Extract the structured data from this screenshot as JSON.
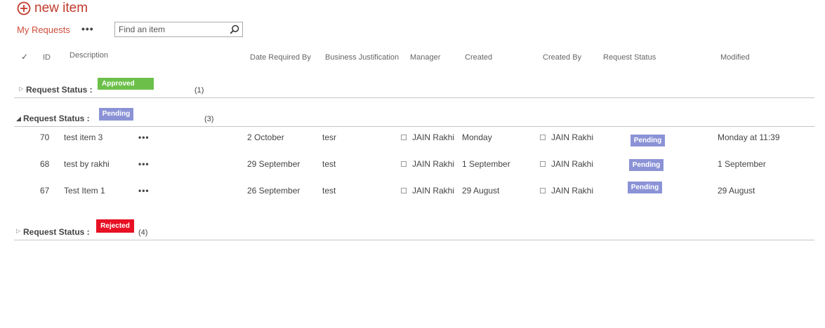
{
  "toolbar": {
    "new_item_label": "new item"
  },
  "view": {
    "name": "My Requests",
    "more": "•••"
  },
  "search": {
    "placeholder": "Find an item"
  },
  "columns": {
    "check": "✓",
    "id": "ID",
    "description": "Description",
    "date_required_by": "Date Required By",
    "business_justification": "Business Justification",
    "manager": "Manager",
    "created": "Created",
    "created_by": "Created By",
    "request_status": "Request Status",
    "modified": "Modified"
  },
  "groups": [
    {
      "label": "Request Status :",
      "status": "Approved",
      "count": "(1)",
      "color": "#6cc04a",
      "expanded": false
    },
    {
      "label": "Request Status :",
      "status": "Pending",
      "count": "(3)",
      "color": "#8b93d6",
      "expanded": true
    },
    {
      "label": "Request Status :",
      "status": "Rejected",
      "count": "(4)",
      "color": "#e81123",
      "expanded": false
    }
  ],
  "rows": [
    {
      "id": "70",
      "description": "test item 3",
      "more": "•••",
      "date_required_by": "2 October",
      "business_justification": "tesr",
      "manager": "JAIN Rakhi",
      "created": "Monday",
      "created_by": "JAIN Rakhi",
      "request_status": "Pending",
      "modified": "Monday at 11:39"
    },
    {
      "id": "68",
      "description": "test by rakhi",
      "more": "•••",
      "date_required_by": "29 September",
      "business_justification": "test",
      "manager": "JAIN Rakhi",
      "created": "1 September",
      "created_by": "JAIN Rakhi",
      "request_status": "Pending",
      "modified": "1 September"
    },
    {
      "id": "67",
      "description": "Test Item 1",
      "more": "•••",
      "date_required_by": "26 September",
      "business_justification": "test",
      "manager": "JAIN Rakhi",
      "created": "29 August",
      "created_by": "JAIN Rakhi",
      "request_status": "Pending",
      "modified": "29 August"
    }
  ],
  "icons": {
    "new_item": "plus-circle-icon",
    "search": "search-icon",
    "collapsed": "triangle-right-icon",
    "expanded": "triangle-down-icon",
    "person": "person-presence-icon"
  },
  "colors": {
    "accent": "#c0392b",
    "approved": "#6cc04a",
    "pending": "#8b93d6",
    "rejected": "#e81123"
  }
}
